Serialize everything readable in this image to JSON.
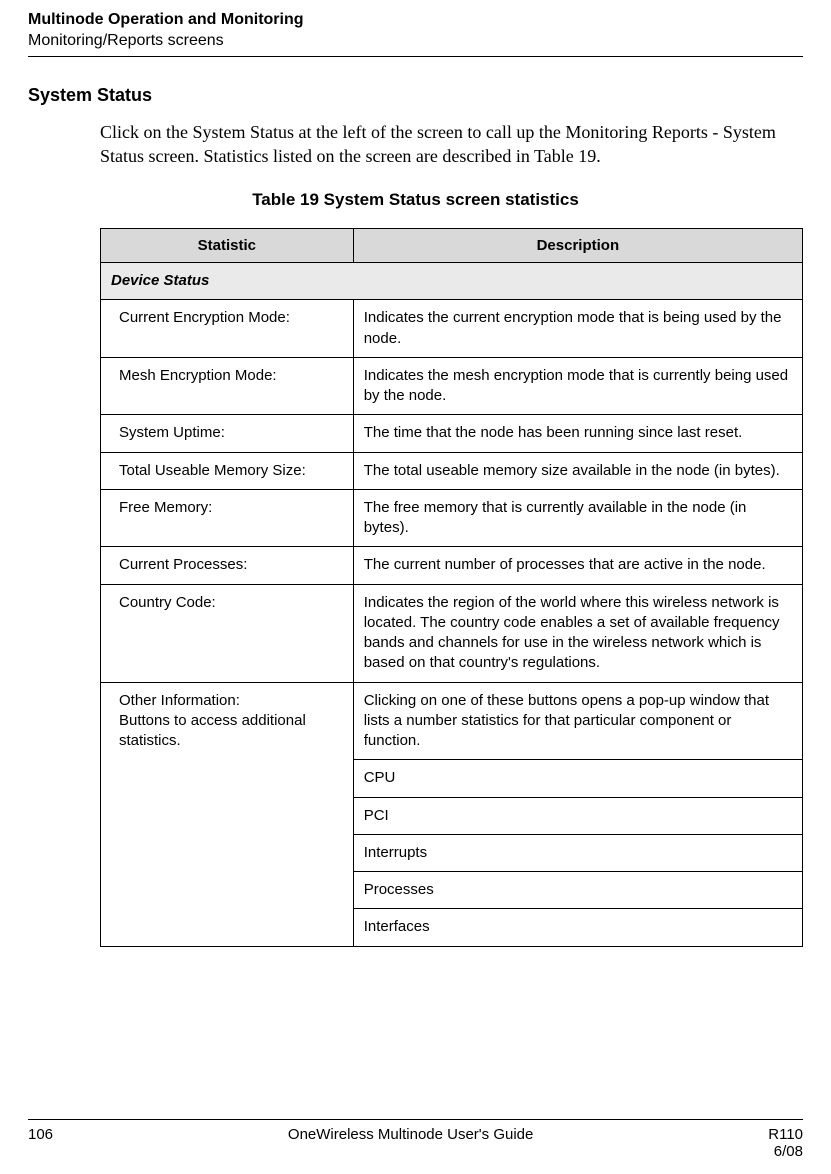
{
  "header": {
    "title": "Multinode Operation and Monitoring",
    "subtitle": "Monitoring/Reports screens"
  },
  "section_heading": "System Status",
  "body_paragraph": "Click on the System Status at the left of the screen to call up the Monitoring Reports - System Status screen. Statistics listed on the screen are described in Table 19.",
  "table": {
    "caption": "Table 19  System Status screen statistics",
    "columns": {
      "stat": "Statistic",
      "desc": "Description"
    },
    "subsection": "Device Status",
    "rows": [
      {
        "stat": "Current Encryption Mode:",
        "desc": "Indicates the current encryption mode that is being used by the node."
      },
      {
        "stat": "Mesh Encryption Mode:",
        "desc": "Indicates the mesh encryption mode that is currently being used by the node."
      },
      {
        "stat": "System Uptime:",
        "desc": "The time that the node has been running since last reset."
      },
      {
        "stat": "Total Useable Memory Size:",
        "desc": "The total useable memory size available in the node (in bytes)."
      },
      {
        "stat": "Free Memory:",
        "desc": "The free memory that is currently available in the node (in bytes)."
      },
      {
        "stat": "Current Processes:",
        "desc": "The current number of processes that are active in the node."
      },
      {
        "stat": "Country Code:",
        "desc": "Indicates the region of the world where this wireless network is located.  The country code enables a set of available frequency bands and channels for use in the wireless network which is based on that country's regulations."
      }
    ],
    "other_info": {
      "stat_line1": "Other Information:",
      "stat_line2": "Buttons to access additional statistics.",
      "desc_intro": "Clicking on one of these buttons opens a pop-up window that lists a number statistics for that particular component or function.",
      "items": [
        "CPU",
        "PCI",
        "Interrupts",
        "Processes",
        "Interfaces"
      ]
    }
  },
  "footer": {
    "page": "106",
    "center": "OneWireless Multinode User's Guide",
    "rev": "R110",
    "date": "6/08"
  }
}
